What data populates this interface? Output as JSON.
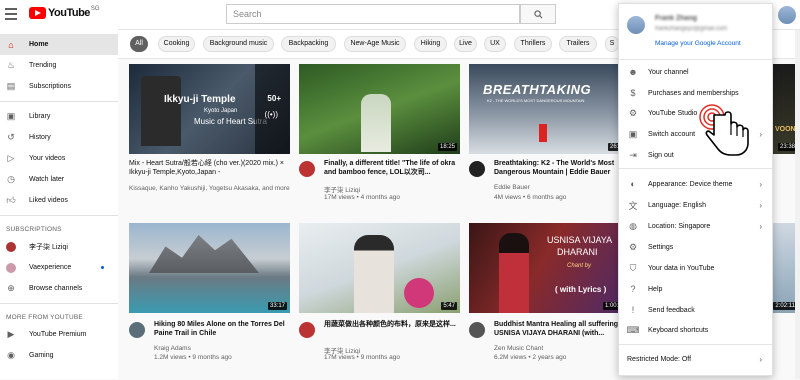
{
  "header": {
    "logo_text": "YouTube",
    "logo_region": "SG",
    "search_placeholder": "Search"
  },
  "sidebar": {
    "items": [
      "Home",
      "Trending",
      "Subscriptions"
    ],
    "library": [
      "Library",
      "History",
      "Your videos",
      "Watch later",
      "Liked videos"
    ],
    "subs_heading": "SUBSCRIPTIONS",
    "subs": [
      "李子柒 Liziqi",
      "Vaexperience",
      "Browse channels"
    ],
    "more_heading": "MORE FROM YOUTUBE",
    "more": [
      "YouTube Premium",
      "Gaming"
    ]
  },
  "chips": [
    "All",
    "Cooking",
    "Background music",
    "Backpacking",
    "New-Age Music",
    "Hiking",
    "Live",
    "UX",
    "Thrillers",
    "Trailers",
    "S"
  ],
  "videos": [
    {
      "title": "Mix - Heart Sutra/般若心経 (cho ver.)(2020 mix.) × Ikkyu-ji Temple,Kyoto,Japan -",
      "desc": "Kissaque, Kanho Yakushiji, Yogetsu Akasaka, and more",
      "overlay1": "Ikkyu-ji Temple",
      "overlay2": "Kyoto Japan",
      "overlay3": "Music of Heart Sutra",
      "count": "50+"
    },
    {
      "title": "Finally, a different title! \"The life of okra and bamboo fence, LOL以次司...",
      "channel": "李子柒 Liziqi",
      "meta": "17M views • 4 months ago",
      "duration": "18:25"
    },
    {
      "title": "Breathtaking: K2 - The World's Most Dangerous Mountain | Eddie Bauer",
      "channel": "Eddie Bauer",
      "meta": "4M views • 6 months ago",
      "duration": "26:05",
      "overlay1": "BREATHTAKING",
      "overlay2": "K2 - THE WORLD'S MOST DANGEROUS MOUNTAIN"
    },
    {
      "title": "Hiking 80 Miles Alone on the Torres Del Paine Trail in Chile",
      "channel": "Kraig Adams",
      "meta": "1.2M views • 9 months ago",
      "duration": "33:17"
    },
    {
      "title": "用蔬菜做出各种颜色的布料，原来是这样...",
      "channel": "李子柒 Liziqi",
      "meta": "17M views • 9 months ago",
      "duration": "5:47"
    },
    {
      "title": "Buddhist Mantra Healing all suffering USNISA VIJAYA DHARANI (with...",
      "channel": "Zen Music Chant",
      "meta": "6.2M views • 2 years ago",
      "duration": "1:00:05",
      "overlay1": "USNISA VIJAYA",
      "overlay2": "DHARANI",
      "overlay3": "Chant by",
      "overlay4": "( with Lyrics )"
    }
  ],
  "peek": {
    "dur1": "23:38",
    "dur2": "2:02:11",
    "label": "VOON"
  },
  "account_menu": {
    "name": "Frank Zhang",
    "email": "frankzhangxyz@gmail.com",
    "manage": "Manage your Google Account",
    "items": [
      "Your channel",
      "Purchases and memberships",
      "YouTube Studio",
      "Switch account",
      "Sign out"
    ],
    "settings_items": [
      "Appearance: Device theme",
      "Language: English",
      "Location: Singapore",
      "Settings",
      "Your data in YouTube",
      "Help",
      "Send feedback",
      "Keyboard shortcuts"
    ],
    "restricted": "Restricted Mode: Off"
  }
}
